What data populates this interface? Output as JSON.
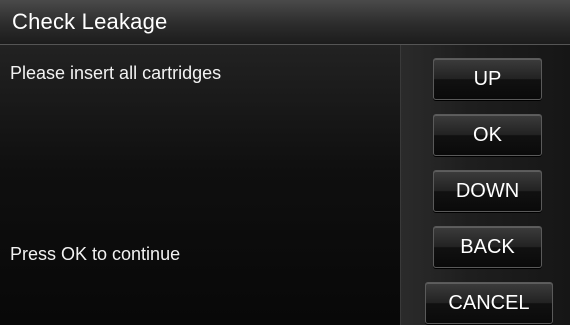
{
  "window": {
    "title": "Check Leakage"
  },
  "messages": {
    "instruction": "Please insert all cartridges",
    "prompt": "Press OK to continue"
  },
  "buttons": {
    "up": "UP",
    "ok": "OK",
    "down": "DOWN",
    "back": "BACK",
    "cancel": "CANCEL"
  },
  "colors": {
    "background": "#0b0b0b",
    "text": "#ffffff",
    "button_border": "#5a5a5a"
  }
}
